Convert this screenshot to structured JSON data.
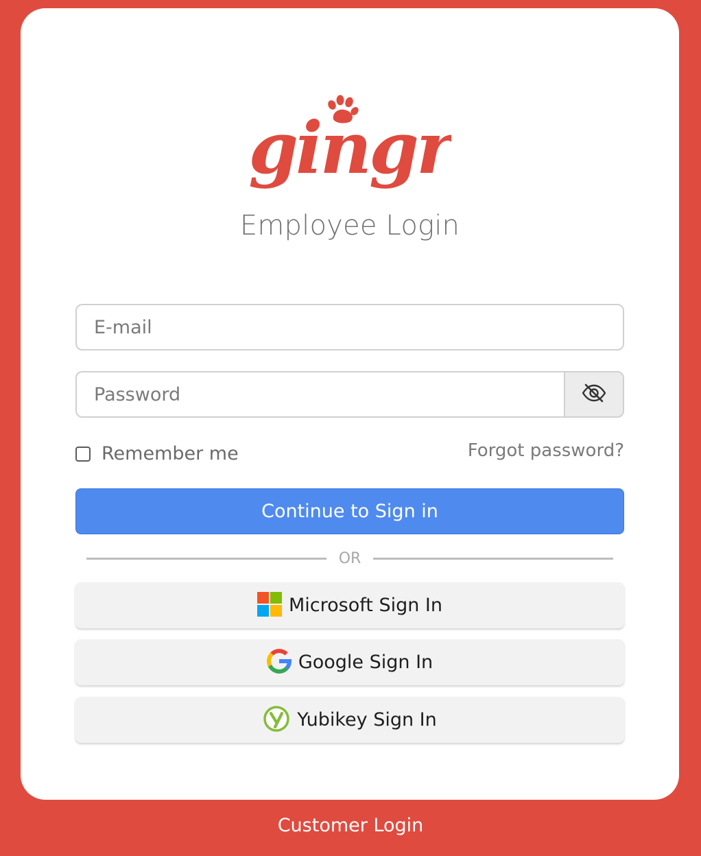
{
  "brand": {
    "logo_text": "gingr",
    "color": "#e04b3f"
  },
  "page_title": "Employee Login",
  "form": {
    "email_placeholder": "E-mail",
    "email_value": "",
    "password_placeholder": "Password",
    "password_value": "",
    "password_toggle_icon": "eye-slash-icon",
    "remember_label": "Remember me",
    "remember_checked": false,
    "forgot_label": "Forgot password?",
    "submit_label": "Continue to Sign in",
    "submit_color": "#4f8aef"
  },
  "divider_label": "OR",
  "sso": {
    "microsoft": {
      "label": "Microsoft Sign In",
      "icon": "microsoft-logo-icon"
    },
    "google": {
      "label": "Google Sign In",
      "icon": "google-logo-icon"
    },
    "yubikey": {
      "label": "Yubikey Sign In",
      "icon": "yubikey-logo-icon"
    }
  },
  "footer": {
    "customer_login_label": "Customer Login"
  }
}
